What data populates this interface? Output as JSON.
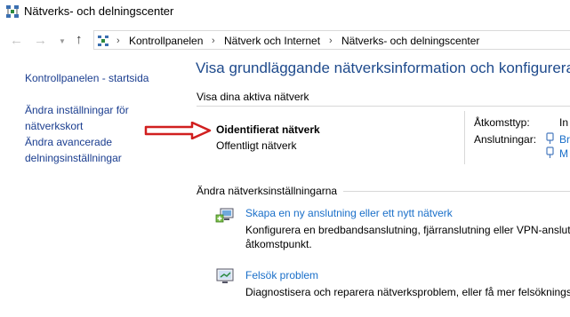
{
  "window": {
    "title": "Nätverks- och delningscenter"
  },
  "address_bar": {
    "breadcrumbs": [
      "Kontrollpanelen",
      "Nätverk och Internet",
      "Nätverks- och delningscenter"
    ]
  },
  "sidebar": {
    "items": [
      {
        "label": "Kontrollpanelen - startsida"
      },
      {
        "label_line1": "Ändra inställningar för",
        "label_line2": "nätverkskort"
      },
      {
        "label_line1": "Ändra avancerade",
        "label_line2": "delningsinställningar"
      }
    ]
  },
  "main": {
    "heading": "Visa grundläggande nätverksinformation och konfigurera an",
    "active_section": "Visa dina aktiva nätverk",
    "network": {
      "name": "Oidentifierat nätverk",
      "type": "Offentligt nätverk"
    },
    "access_label": "Åtkomsttyp:",
    "access_value": "In",
    "connections_label": "Anslutningar:",
    "connection_1": "Br",
    "connection_2": "M",
    "change_section": "Ändra nätverksinställningarna",
    "actions": [
      {
        "link": "Skapa en ny anslutning eller ett nytt nätverk",
        "desc_line1": "Konfigurera en bredbandsanslutning, fjärranslutning eller VPN-anslut",
        "desc_line2": "åtkomstpunkt."
      },
      {
        "link": "Felsök problem",
        "desc_line1": "Diagnostisera och reparera nätverksproblem, eller få mer felsökningsin"
      }
    ]
  },
  "colors": {
    "link": "#1a3d8f",
    "heading": "#1e4a8c",
    "arrow": "#d11f1f"
  }
}
